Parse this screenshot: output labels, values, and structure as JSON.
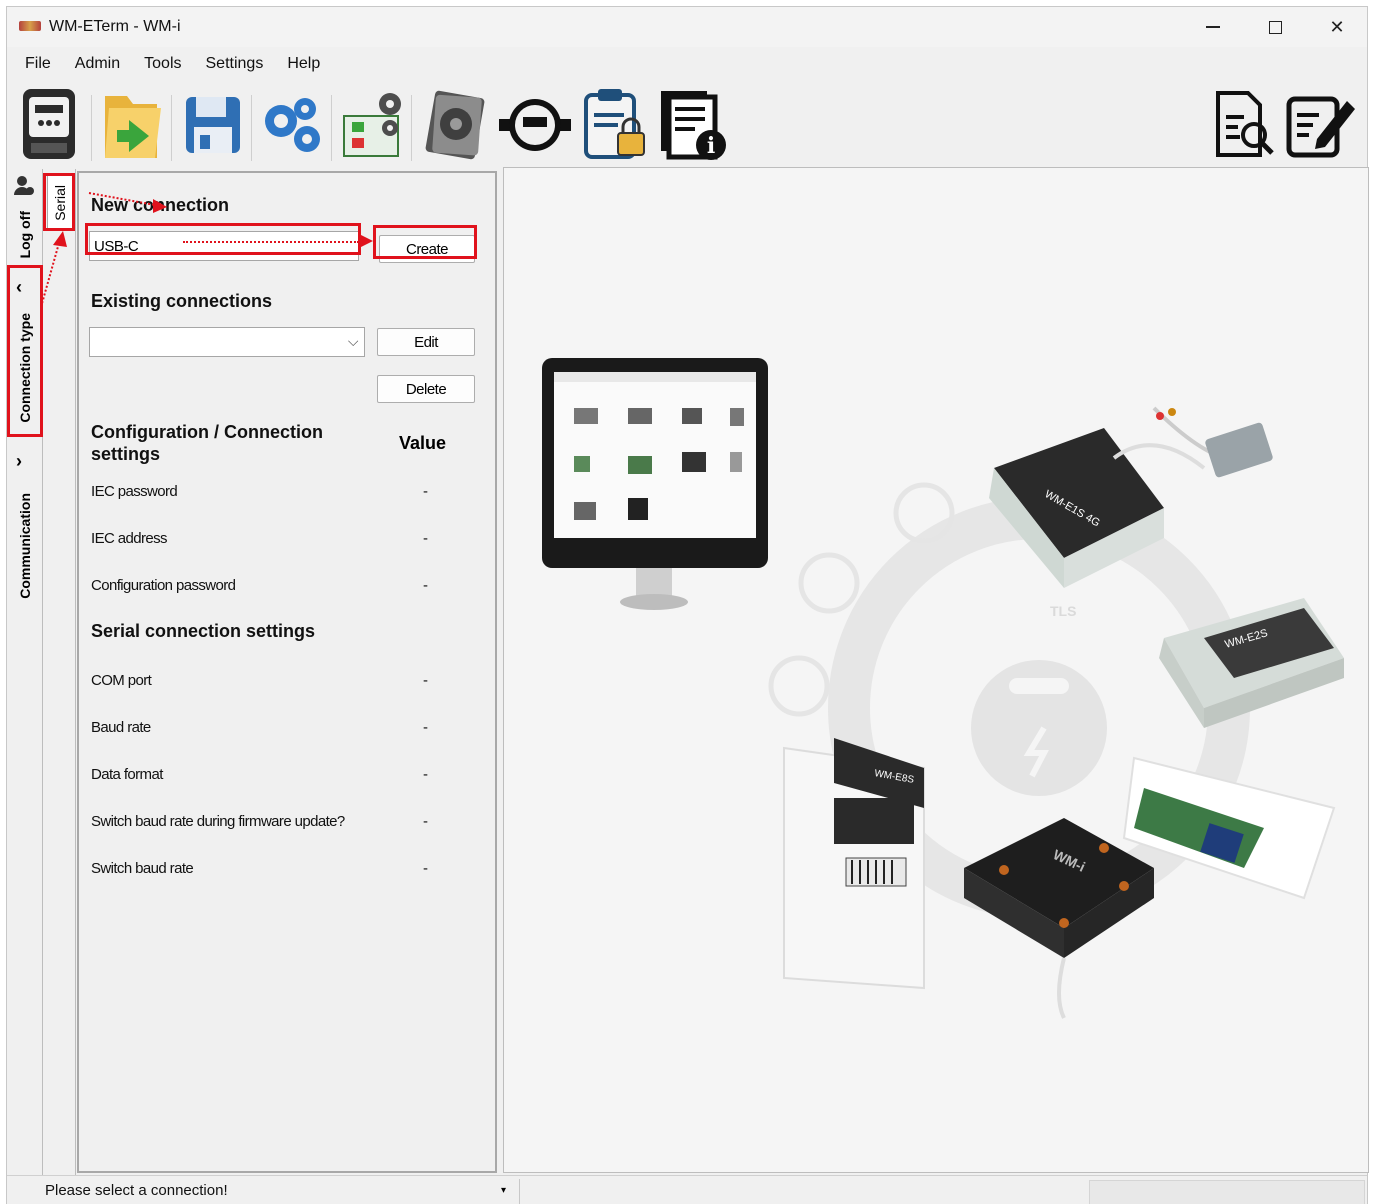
{
  "window": {
    "title": "WM-ETerm - WM-i"
  },
  "menubar": {
    "items": [
      "File",
      "Admin",
      "Tools",
      "Settings",
      "Help"
    ]
  },
  "toolbar": {
    "buttons": [
      {
        "icon": "meter-icon"
      },
      {
        "icon": "open-folder-icon"
      },
      {
        "icon": "save-disk-icon"
      },
      {
        "icon": "gears-icon"
      },
      {
        "icon": "checklist-settings-icon"
      },
      {
        "icon": "firmware-disk-icon"
      },
      {
        "icon": "water-meter-icon"
      },
      {
        "icon": "locked-clipboard-icon"
      },
      {
        "icon": "document-info-icon"
      },
      {
        "icon": "document-search-icon"
      },
      {
        "icon": "edit-document-icon"
      }
    ]
  },
  "sidetabs": {
    "logoff": "Log off",
    "connection_type": "Connection type",
    "communication": "Communication",
    "serial": "Serial"
  },
  "left_panel": {
    "new_connection_title": "New connection",
    "new_connection_value": "USB-C",
    "create_label": "Create",
    "existing_title": "Existing connections",
    "existing_selected": "",
    "edit_label": "Edit",
    "delete_label": "Delete",
    "config_title": "Configuration / Connection settings",
    "value_header": "Value",
    "config_rows": [
      {
        "label": "IEC password",
        "value": "-"
      },
      {
        "label": "IEC address",
        "value": "-"
      },
      {
        "label": "Configuration password",
        "value": "-"
      }
    ],
    "serial_title": "Serial connection settings",
    "serial_rows": [
      {
        "label": "COM port",
        "value": "-"
      },
      {
        "label": "Baud rate",
        "value": "-"
      },
      {
        "label": "Data format",
        "value": "-"
      },
      {
        "label": "Switch baud rate during firmware update?",
        "value": "-"
      },
      {
        "label": "Switch baud rate",
        "value": "-"
      }
    ]
  },
  "right_panel": {
    "product_labels": [
      "WM-E1S 4G",
      "WM-E2S",
      "WM-E8S",
      "WM-i",
      "TLS"
    ]
  },
  "status": {
    "message": "Please select a connection!"
  },
  "colors": {
    "annotation_red": "#e0121c",
    "window_bg": "#f0f0f0"
  }
}
